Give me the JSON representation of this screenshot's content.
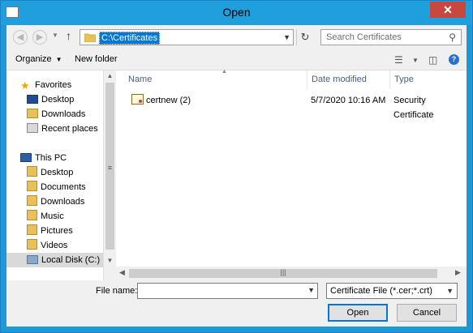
{
  "window": {
    "title": "Open",
    "close_label": "✕"
  },
  "address": {
    "path": "C:\\Certificates"
  },
  "search": {
    "placeholder": "Search Certificates"
  },
  "toolbar": {
    "organize_label": "Organize",
    "new_folder_label": "New folder"
  },
  "sidebar": {
    "favorites_label": "Favorites",
    "favorites": [
      "Desktop",
      "Downloads",
      "Recent places"
    ],
    "thispc_label": "This PC",
    "thispc": [
      "Desktop",
      "Documents",
      "Downloads",
      "Music",
      "Pictures",
      "Videos",
      "Local Disk (C:)"
    ]
  },
  "columns": {
    "name": "Name",
    "date": "Date modified",
    "type": "Type"
  },
  "files": [
    {
      "name": "certnew (2)",
      "date": "5/7/2020 10:16 AM",
      "type": "Security Certificate"
    }
  ],
  "footer": {
    "filename_label": "File name:",
    "filename_value": "",
    "filetype_selected": "Certificate File (*.cer;*.crt)",
    "open_label": "Open",
    "cancel_label": "Cancel"
  },
  "colors": {
    "titlebar": "#1fa0dd",
    "close": "#c7483f",
    "selection": "#0078d7"
  },
  "icons": [
    "back-icon",
    "forward-icon",
    "up-icon",
    "folder-icon",
    "refresh-icon",
    "search-icon",
    "star-icon",
    "computer-icon",
    "drive-icon",
    "certificate-icon",
    "view-icon",
    "preview-pane-icon",
    "help-icon"
  ]
}
